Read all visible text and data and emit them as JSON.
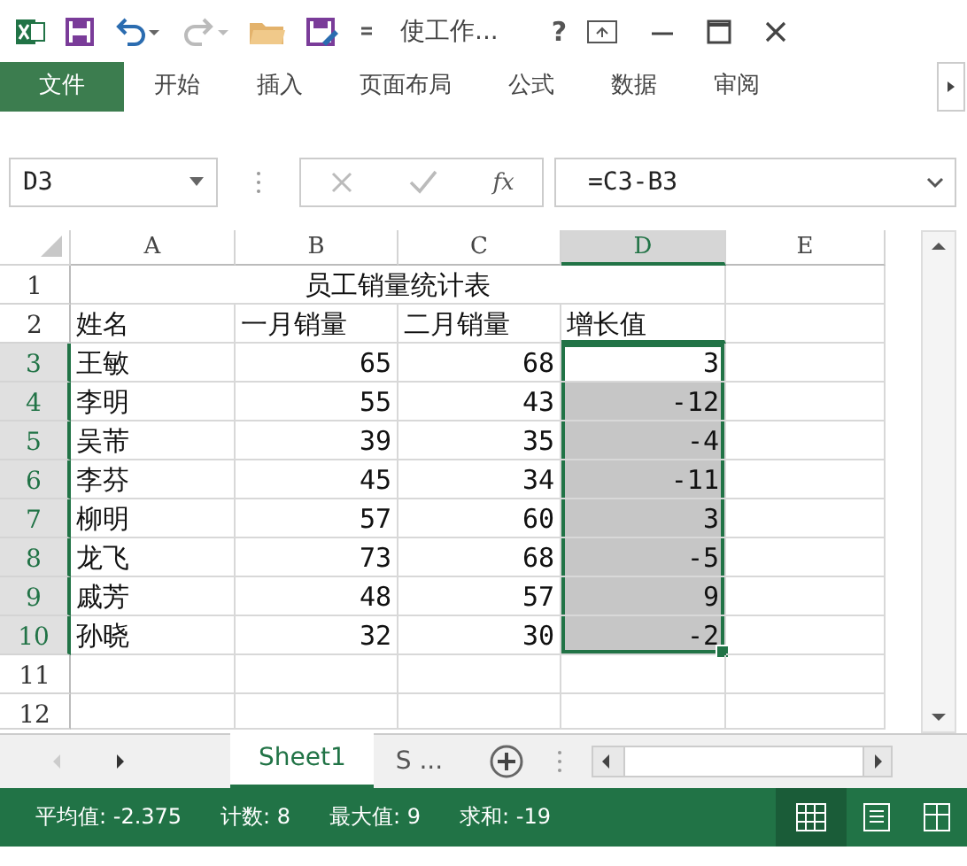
{
  "window": {
    "title": "使工作...",
    "help": "?"
  },
  "ribbon_tabs": [
    {
      "label": "文件",
      "kind": "file"
    },
    {
      "label": "开始",
      "kind": "tab"
    },
    {
      "label": "插入",
      "kind": "tab"
    },
    {
      "label": "页面布局",
      "kind": "tab"
    },
    {
      "label": "公式",
      "kind": "tab"
    },
    {
      "label": "数据",
      "kind": "tab"
    },
    {
      "label": "审阅",
      "kind": "tab"
    }
  ],
  "formula_bar": {
    "name_box": "D3",
    "fx": "fx",
    "formula": "=C3-B3"
  },
  "columns": [
    {
      "label": "A",
      "selected": false
    },
    {
      "label": "B",
      "selected": false
    },
    {
      "label": "C",
      "selected": false
    },
    {
      "label": "D",
      "selected": true
    },
    {
      "label": "E",
      "selected": false
    }
  ],
  "title_row": {
    "number": "1",
    "text": "员工销量统计表"
  },
  "header_row": {
    "number": "2",
    "cells": [
      "姓名",
      "一月销量",
      "二月销量",
      "增长值"
    ]
  },
  "data_rows": [
    {
      "number": "3",
      "name": "王敏",
      "jan": "65",
      "feb": "68",
      "growth": "3",
      "selected": true,
      "active": true
    },
    {
      "number": "4",
      "name": "李明",
      "jan": "55",
      "feb": "43",
      "growth": "-12",
      "selected": true,
      "active": false
    },
    {
      "number": "5",
      "name": "吴芾",
      "jan": "39",
      "feb": "35",
      "growth": "-4",
      "selected": true,
      "active": false
    },
    {
      "number": "6",
      "name": "李芬",
      "jan": "45",
      "feb": "34",
      "growth": "-11",
      "selected": true,
      "active": false
    },
    {
      "number": "7",
      "name": "柳明",
      "jan": "57",
      "feb": "60",
      "growth": "3",
      "selected": true,
      "active": false
    },
    {
      "number": "8",
      "name": "龙飞",
      "jan": "73",
      "feb": "68",
      "growth": "-5",
      "selected": true,
      "active": false
    },
    {
      "number": "9",
      "name": "戚芳",
      "jan": "48",
      "feb": "57",
      "growth": "9",
      "selected": true,
      "active": false
    },
    {
      "number": "10",
      "name": "孙晓",
      "jan": "32",
      "feb": "30",
      "growth": "-2",
      "selected": true,
      "active": false
    }
  ],
  "empty_rows": [
    "11",
    "12"
  ],
  "sheet_tabs": [
    {
      "label": "Sheet1",
      "selected": true
    },
    {
      "label": "S ...",
      "selected": false
    }
  ],
  "status_bar": [
    "平均值: -2.375",
    "计数: 8",
    "最大值: 9",
    "求和: -19"
  ]
}
